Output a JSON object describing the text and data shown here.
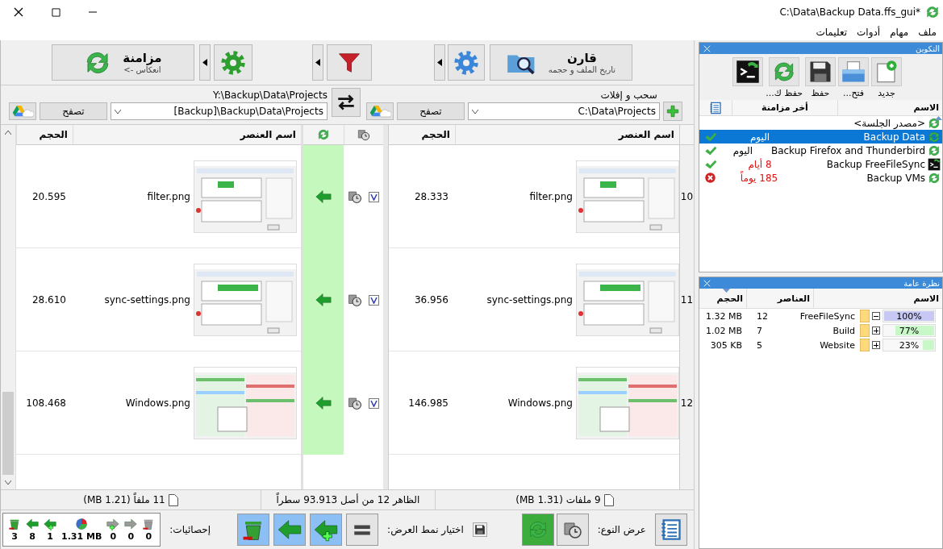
{
  "window": {
    "title": "C:\\Data\\Backup Data.ffs_gui*"
  },
  "menu": [
    {
      "label": "ملف"
    },
    {
      "label": "مهام"
    },
    {
      "label": "أدوات"
    },
    {
      "label": "تعليمات"
    }
  ],
  "toolbar": {
    "compare": {
      "label": "قارن",
      "sublabel": "تاريخ الملف و حجمه"
    },
    "sync": {
      "label": "مزامنة",
      "sublabel": "انعكاس ->"
    }
  },
  "folders": {
    "source": {
      "label": "سحب و إفلات",
      "path": "C:\\Data\\Projects",
      "browse": "تصفح"
    },
    "target": {
      "label": "Y:\\Backup\\Data\\Projects",
      "path": "[Backup]\\Backup\\Data\\Projects",
      "browse": "تصفح"
    }
  },
  "grid": {
    "source_columns": [
      "اسم العنصر",
      "الحجم"
    ],
    "target_columns": [
      "اسم العنصر",
      "الحجم"
    ],
    "rows": [
      {
        "number": "10",
        "source_name": "filter.png",
        "source_size": "28.333",
        "kind": "update_left",
        "checked": true,
        "target_name": "filter.png",
        "target_size": "20.595"
      },
      {
        "number": "11",
        "source_name": "sync-settings.png",
        "source_size": "36.956",
        "kind": "update_left",
        "checked": true,
        "target_name": "sync-settings.png",
        "target_size": "28.610"
      },
      {
        "number": "12",
        "source_name": "Windows.png",
        "source_size": "146.985",
        "kind": "update_left",
        "checked": true,
        "target_name": "Windows.png",
        "target_size": "108.468"
      }
    ]
  },
  "status_bar": {
    "source": "9 ملفات (1.31 MB)",
    "center": "الظاهر 12 من أصل 93.913 سطراً",
    "target": "11 ملفاً (1.21 MB)"
  },
  "bottom_bar": {
    "view_label": "عرض النوع:",
    "view_types": [
      {
        "kind": "compare",
        "selected": false
      },
      {
        "kind": "sync",
        "selected": true
      }
    ],
    "filter_label": "اختيار نمط العرض:",
    "filters": [
      {
        "kind": "equal",
        "selected": false
      },
      {
        "kind": "create_left",
        "selected": true
      },
      {
        "kind": "update_left",
        "selected": true
      },
      {
        "kind": "delete_left",
        "selected": true
      }
    ],
    "stats_label": "إحصائيات:",
    "stats": [
      {
        "kind": "delete_right",
        "value": "0"
      },
      {
        "kind": "update_right",
        "value": "0"
      },
      {
        "kind": "create_right",
        "value": "0"
      },
      {
        "kind": "bytes",
        "value": "1.31 MB"
      },
      {
        "kind": "create_left",
        "value": "1"
      },
      {
        "kind": "update_left",
        "value": "8"
      },
      {
        "kind": "delete_left",
        "value": "3"
      }
    ]
  },
  "config_panel": {
    "title": "التكوين",
    "buttons": [
      {
        "kind": "new",
        "label": "جديد"
      },
      {
        "kind": "open",
        "label": "فتح..."
      },
      {
        "kind": "save",
        "label": "حفظ"
      },
      {
        "kind": "save_as",
        "label": "حفظ ك..."
      },
      {
        "kind": "save_batch"
      }
    ],
    "columns": [
      "الاسم",
      "أخر مزامنة"
    ],
    "rows": [
      {
        "kind": "sync",
        "name": "<مصدر الجلسة>",
        "selected": false
      },
      {
        "kind": "sync",
        "name": "Backup Data",
        "last_sync": "اليوم",
        "overdue": false,
        "failed": false,
        "selected": true
      },
      {
        "kind": "sync",
        "name": "Backup Firefox and Thunderbird",
        "last_sync": "اليوم",
        "overdue": false,
        "failed": false,
        "selected": false
      },
      {
        "kind": "batch",
        "name": "Backup FreeFileSync",
        "last_sync": "8 أيام",
        "overdue": true,
        "failed": false,
        "selected": false
      },
      {
        "kind": "sync",
        "name": "Backup VMs",
        "last_sync": "185 يوماً",
        "overdue": true,
        "failed": true,
        "selected": false
      }
    ]
  },
  "overview_panel": {
    "title": "نظرة عامة",
    "columns": [
      "الاسم",
      "العناصر",
      "الحجم"
    ],
    "rows": [
      {
        "name": "FreeFileSync",
        "items": "12",
        "size": "1.32 MB",
        "expanded": true,
        "level": 1,
        "percent": "100%",
        "selected": true
      },
      {
        "name": "Build",
        "items": "7",
        "size": "1.02 MB",
        "expanded": false,
        "level": 0.77,
        "percent": "77%",
        "selected": false
      },
      {
        "name": "Website",
        "items": "5",
        "size": "305 KB",
        "expanded": false,
        "level": 0.23,
        "percent": "23%",
        "selected": false
      }
    ]
  }
}
